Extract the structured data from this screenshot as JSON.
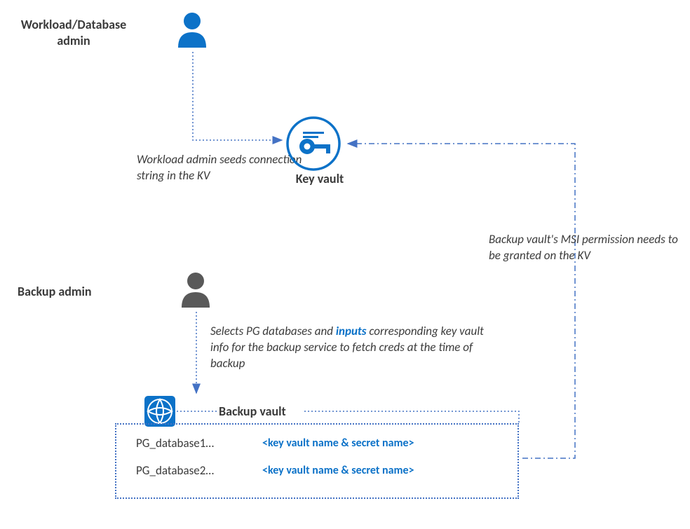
{
  "workload_admin": {
    "title": "Workload/Database admin",
    "seed_text": "Workload admin seeds connection string in the KV"
  },
  "key_vault": {
    "label": "Key vault"
  },
  "backup_admin": {
    "title": "Backup admin",
    "selects_prefix": "Selects PG databases and ",
    "selects_accent": "inputs",
    "selects_suffix": " corresponding key vault info for the backup service to fetch creds at the time of  backup"
  },
  "backup_vault": {
    "label": "Backup vault",
    "rows": [
      {
        "db": "PG_database1…",
        "kv": "<key vault name & secret name>"
      },
      {
        "db": "PG_database2…",
        "kv": "<key vault name & secret name>"
      }
    ]
  },
  "msi_note": "Backup vault's MSI permission needs to be granted on the KV"
}
